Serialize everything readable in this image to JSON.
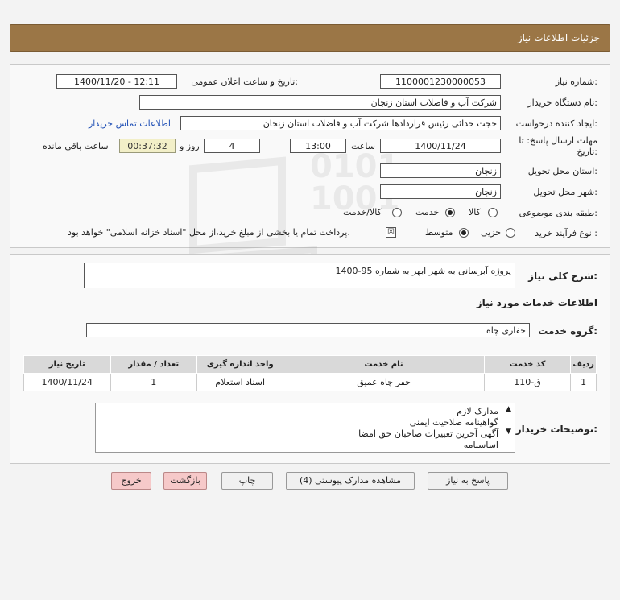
{
  "header": {
    "title": "جزئیات اطلاعات نیاز"
  },
  "info": {
    "need_number_label": "شماره نیاز:",
    "need_number": "1100001230000053",
    "announce_label": "تاریخ و ساعت اعلان عمومی:",
    "announce_value": "1400/11/20 - 12:11",
    "buyer_org_label": "نام دستگاه خریدار:",
    "buyer_org": "شرکت آب و فاضلاب استان زنجان",
    "creator_label": "ایجاد کننده درخواست:",
    "creator": "حجت  خدائی رئیس قراردادها شرکت آب و فاضلاب استان زنجان",
    "contact_link": "اطلاعات تماس خریدار",
    "deadline_label_1": "مهلت ارسال پاسخ: تا",
    "deadline_label_2": "تاریخ:",
    "deadline_date": "1400/11/24",
    "time_label": "ساعت",
    "deadline_time": "13:00",
    "days_value": "4",
    "days_label": "روز و",
    "remaining_time": "00:37:32",
    "remaining_label": "ساعت باقی مانده",
    "province_label": "استان محل تحویل:",
    "province": "زنجان",
    "city_label": "شهر محل تحویل:",
    "city": "زنجان",
    "category_label": "طبقه بندی موضوعی:",
    "category_options": [
      "کالا",
      "خدمت",
      "کالا/خدمت"
    ],
    "category_selected": "خدمت",
    "process_label": "نوع فرآیند خرید :",
    "process_options": [
      "جزیی",
      "متوسط"
    ],
    "process_selected": "متوسط",
    "treasury_note": "پرداخت تمام یا بخشی از مبلغ خرید،از محل \"اسناد خزانه اسلامی\" خواهد بود."
  },
  "need": {
    "summary_label": "شرح کلی نیاز:",
    "summary": "پروژه آبرسانی به شهر ابهر به شماره 95-1400",
    "services_heading": "اطلاعات خدمات مورد نیاز",
    "service_group_label": "گروه خدمت:",
    "service_group": "حفاری چاه",
    "table": {
      "headers": [
        "ردیف",
        "کد خدمت",
        "نام خدمت",
        "واحد اندازه گیری",
        "تعداد / مقدار",
        "تاریخ نیاز"
      ],
      "rows": [
        [
          "1",
          "ق-110",
          "حفر چاه عمیق",
          "اسناد استعلام",
          "1",
          "1400/11/24"
        ]
      ]
    },
    "buyer_notes_label": "توضیحات خریدار:",
    "buyer_notes": [
      "مدارک لازم",
      "گواهینامه صلاحیت ایمنی",
      "آگهی آخرین تغییرات صاحبان حق امضا",
      "اساسنامه"
    ]
  },
  "buttons": {
    "reply": "پاسخ به نیاز",
    "view_docs": "مشاهده مدارک پیوستی (4)",
    "print": "چاپ",
    "back": "بازگشت",
    "exit": "خروج"
  }
}
